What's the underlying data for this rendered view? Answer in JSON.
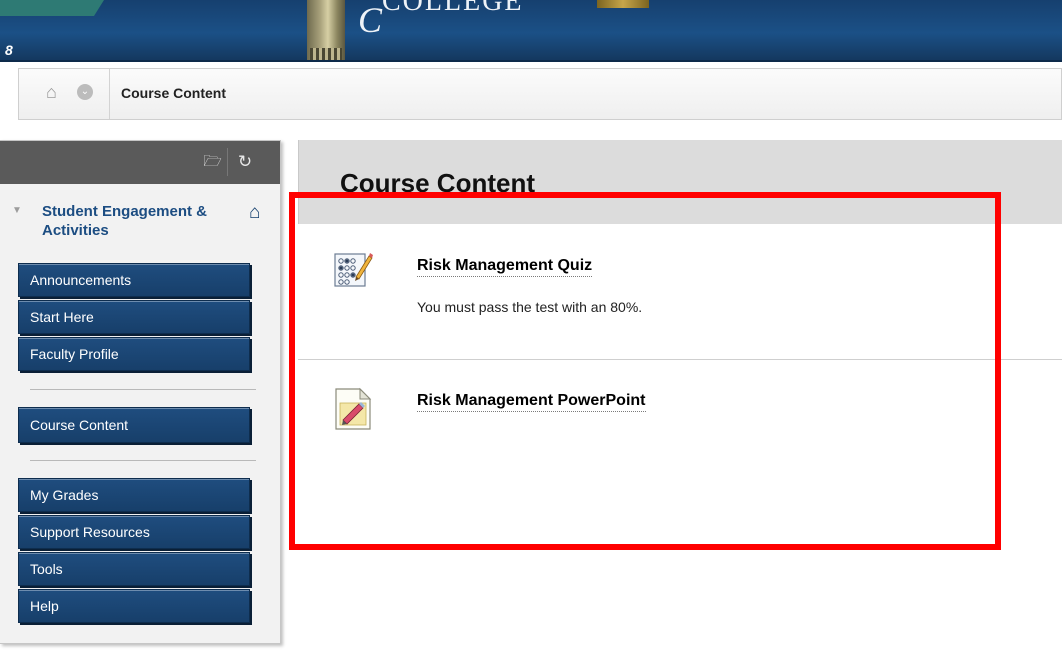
{
  "banner": {
    "monogram": "C",
    "college_word": "COLLEGE",
    "link_glyph": "8"
  },
  "breadcrumb": {
    "current": "Course Content"
  },
  "sidebar": {
    "course_title": "Student Engagement & Activities",
    "items": [
      {
        "label": "Announcements"
      },
      {
        "label": "Start Here"
      },
      {
        "label": "Faculty Profile"
      },
      {
        "label": "Course Content"
      },
      {
        "label": "My Grades"
      },
      {
        "label": "Support Resources"
      },
      {
        "label": "Tools"
      },
      {
        "label": "Help"
      }
    ]
  },
  "main": {
    "title": "Course Content",
    "items": [
      {
        "title": "Risk Management Quiz",
        "description": "You must pass the test with an 80%.",
        "icon": "quiz-icon"
      },
      {
        "title": "Risk Management PowerPoint",
        "description": "",
        "icon": "document-icon"
      }
    ]
  },
  "colors": {
    "banner": "#1b5086",
    "menu_button": "#1f4d7f",
    "course_title": "#1c4d82",
    "annotation": "#ff0000"
  }
}
